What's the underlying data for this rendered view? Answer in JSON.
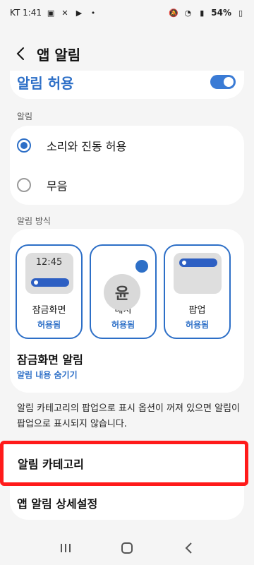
{
  "status_bar": {
    "carrier_time": "KT 1:41",
    "battery": "54%"
  },
  "header": {
    "title": "앱 알림"
  },
  "master": {
    "label": "알림 허용",
    "enabled": true
  },
  "sections": {
    "alerts_label": "알림",
    "style_label": "알림 방식"
  },
  "alert_options": [
    {
      "label": "소리와 진동 허용",
      "selected": true
    },
    {
      "label": "무음",
      "selected": false
    }
  ],
  "styles": [
    {
      "name": "잠금화면",
      "status": "허용됨",
      "preview_time": "12:45"
    },
    {
      "name": "배지",
      "status": "허용됨",
      "badge_app_glyph": "윤"
    },
    {
      "name": "팝업",
      "status": "허용됨"
    }
  ],
  "lock_screen": {
    "title": "잠금화면 알림",
    "subtitle": "알림 내용 숨기기"
  },
  "info": {
    "text": "알림 카테고리의 팝업으로 표시 옵션이 꺼져 있으면 알림이 팝업으로 표시되지 않습니다."
  },
  "category": {
    "label": "알림 카테고리",
    "highlight_color": "#ff1a1a"
  },
  "detail": {
    "label": "앱 알림 상세설정"
  },
  "colors": {
    "accent": "#2d6fc7",
    "background": "#f5f5f5"
  },
  "icons": [
    "back-arrow-icon",
    "recent-apps-icon",
    "home-icon",
    "back-nav-icon"
  ]
}
